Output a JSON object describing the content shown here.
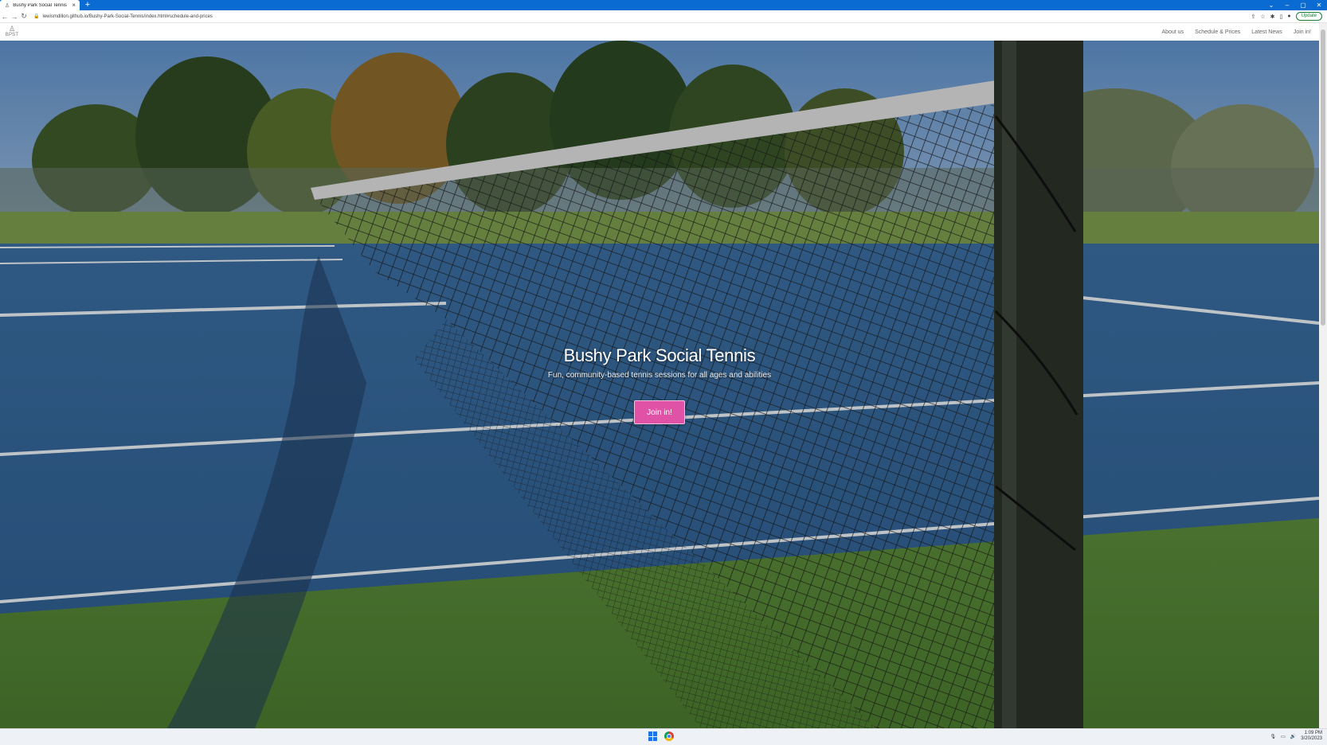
{
  "browser": {
    "tab_title": "Bushy Park Social Tennis",
    "new_tab_label": "+",
    "url": "lewismdillon.github.io/Bushy-Park-Social-Tennis/index.html#schedule-and-prices",
    "update_label": "Update"
  },
  "site": {
    "brand_text": "BPST",
    "nav": [
      {
        "label": "About us"
      },
      {
        "label": "Schedule & Prices"
      },
      {
        "label": "Latest News"
      },
      {
        "label": "Join in!"
      }
    ]
  },
  "hero": {
    "title": "Bushy Park Social Tennis",
    "subtitle": "Fun, community-based tennis sessions for all ages and abilities",
    "cta_label": "Join in!",
    "accent_color": "#e052a5"
  },
  "taskbar": {
    "time": "1:09 PM",
    "date": "3/20/2023"
  }
}
